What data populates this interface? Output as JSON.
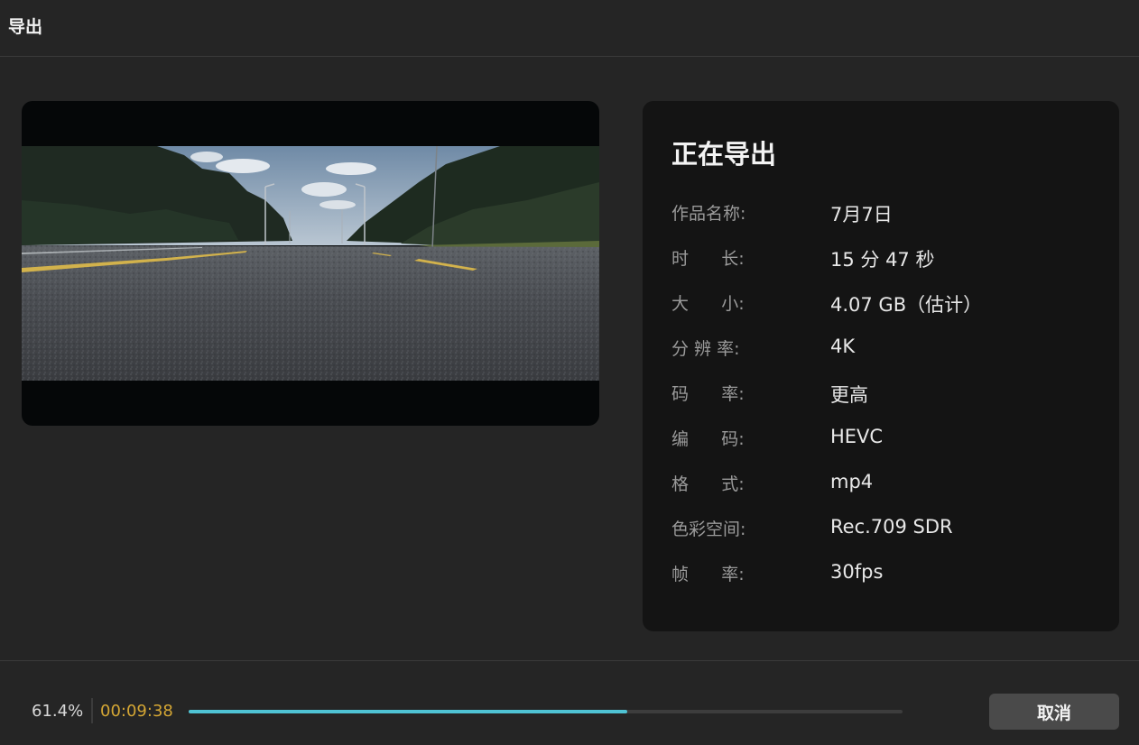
{
  "window": {
    "title": "导出"
  },
  "info": {
    "heading": "正在导出",
    "rows": [
      {
        "label": "作品名称:",
        "value": "7月7日"
      },
      {
        "label": "时      长:",
        "value": "15 分 47 秒"
      },
      {
        "label": "大      小:",
        "value": "4.07 GB（估计）"
      },
      {
        "label": "分 辨 率:",
        "value": "4K"
      },
      {
        "label": "码      率:",
        "value": "更高"
      },
      {
        "label": "编      码:",
        "value": "HEVC"
      },
      {
        "label": "格      式:",
        "value": "mp4"
      },
      {
        "label": "色彩空间:",
        "value": "Rec.709 SDR"
      },
      {
        "label": "帧      率:",
        "value": "30fps"
      }
    ]
  },
  "progress": {
    "percent_text": "61.4%",
    "fraction": 0.614,
    "elapsed": "00:09:38",
    "fill_color": "#4fc3d4",
    "elapsed_color": "#d4a634"
  },
  "actions": {
    "cancel_label": "取消"
  },
  "preview": {
    "description_icon": "video-frame-road"
  }
}
